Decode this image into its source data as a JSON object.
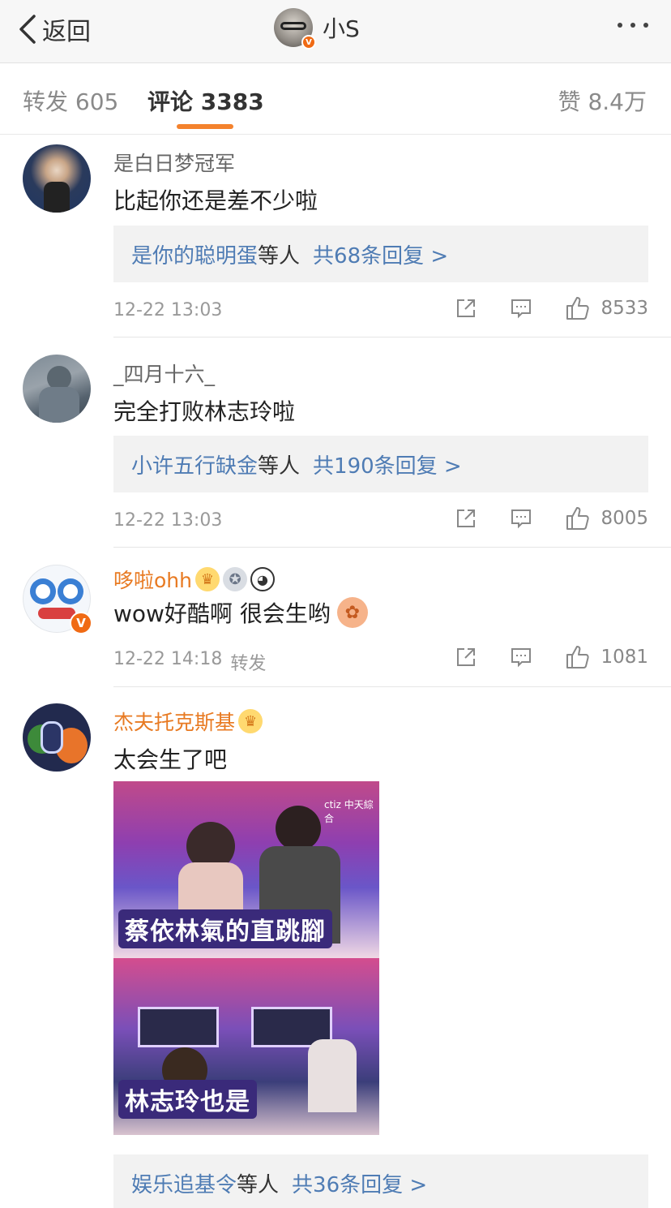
{
  "nav": {
    "back_label": "返回",
    "title": "小S",
    "avatar_badge": "V"
  },
  "tabs": {
    "repost": "转发 605",
    "comment": "评论 3383",
    "like": "赞 8.4万"
  },
  "comments": [
    {
      "username": "是白日梦冠军",
      "text": "比起你还是差不少啦",
      "reply_users": "是你的聪明蛋",
      "reply_suffix": "等人",
      "reply_count": "共68条回复 >",
      "time": "12-22 13:03",
      "likes": "8533"
    },
    {
      "username": "_四月十六_",
      "text": "完全打败林志玲啦",
      "reply_users": "小许五行缺金",
      "reply_suffix": "等人",
      "reply_count": "共190条回复 >",
      "time": "12-22 13:03",
      "likes": "8005"
    },
    {
      "username": "哆啦ohh",
      "text": "wow好酷啊 很会生哟",
      "time": "12-22 14:18",
      "repost_label": "转发",
      "likes": "1081",
      "avatar_badge": "V",
      "badge_icons": [
        "crown-icon",
        "medal-icon",
        "panda-icon"
      ],
      "emoji_icon": "octopus-emoji-icon"
    },
    {
      "username": "杰夫托克斯基",
      "text": "太会生了吧",
      "badge_icons": [
        "crown-icon"
      ],
      "image": {
        "top_caption": "蔡依林氣的直跳腳",
        "bottom_caption": "林志玲也是",
        "channel_tag": "ctiz 中天綜合"
      },
      "reply_users": "娱乐追基令",
      "reply_suffix": "等人",
      "reply_count": "共36条回复 >"
    }
  ],
  "colors": {
    "accent": "#f4822d",
    "link": "#4f7cb4",
    "vip_name": "#e87a22"
  }
}
